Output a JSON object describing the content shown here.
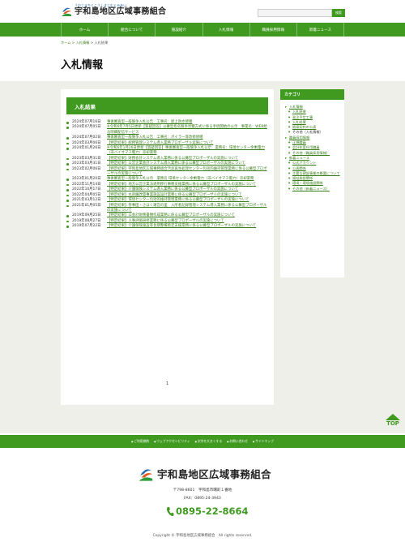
{
  "header": {
    "tagline": "うわじまちくこうしきじむくみあい",
    "site_name": "宇和島地区広域事務組合",
    "search_placeholder": "",
    "search_button": "検索"
  },
  "nav": {
    "items": [
      "ホーム",
      "組合について",
      "施設紹介",
      "入札情報",
      "職員採用情報",
      "新着ニュース"
    ]
  },
  "breadcrumb": {
    "home": "ホーム",
    "sep1": " > ",
    "parent": "入札情報",
    "sep2": " > ",
    "current": "入札結果"
  },
  "page_title": "入札情報",
  "main": {
    "heading": "入札結果",
    "items": [
      {
        "date": "2024年07月16日",
        "title": "事後審査型一般競争入札公告　工事名：屋上防水修繕"
      },
      {
        "date": "2024年07月05日",
        "title": "※令和6年7月5日更新【質疑回答】公募型指名競争見積方式に係る手続開始の公示　事業名：WEB給与明細配信サービス"
      },
      {
        "date": "2024年07月02日",
        "title": "事後審査型一般競争入札公告　工事名：ボイラー等改修修繕"
      },
      {
        "date": "2024年03月06日",
        "title": "【特定結果】総務管理システム導入業務プロポーザル実施について"
      },
      {
        "date": "2024年01月26日",
        "title": "※令和6年1月26日更新【質疑回答】事後審査型一般競争入札公示　業務名：環境センター余剰電力（非バイオマス電力）売却業務"
      },
      {
        "date": "2023年03月31日",
        "title": "【特定結果】財務会計システム導入業務に係る公募型プロポーザルの実施について"
      },
      {
        "date": "2023年03月31日",
        "title": "【特定結果】公営企業会計システム導入業務に係る公募型プロポーザルの実施について"
      },
      {
        "date": "2023年02月06日",
        "title": "【特定結果】宇和島地区広域事務組合汚泥再生処理センター包括的維持管理業務に係る公募型プロポーザルの実施について"
      },
      {
        "date": "2023年01月20日",
        "title": "事後審査型一般競争入札公示　業務名 環境センター余剰電力（非バイオマス電力）売却業務"
      },
      {
        "date": "2022年11月14日",
        "title": "【特定結果】地方公営企業法適用移行事務支援業務に係る公募型プロポーザルの実施について"
      },
      {
        "date": "2022年10月17日",
        "title": "【特定結果】介護保険システム導入業務に係る公募型プロポーザルの実施について"
      },
      {
        "date": "2022年04月05日",
        "title": "【特定結果】丸串園改築事業施設設計業務に係る公募型プロポーザルの実施について"
      },
      {
        "date": "2021年03月12日",
        "title": "【特定結果】環境センター包括的維持管理業務に係る公募型プロポーザルの実施について"
      },
      {
        "date": "2021年01月05日",
        "title": "【特定結果】券事田・さほく運営の里　入所者記録管理システム導入業務に係る公募型プロポーザルの実施について"
      },
      {
        "date": "2019年09月25日",
        "title": "【特定結果】公会計財務書類作成業務に係る公募型プロポーザルの実施について"
      },
      {
        "date": "2019年08月27日",
        "title": "【特定結果】人事評価研修業務に係る公募型プロポーザルの実施について"
      },
      {
        "date": "2019年07月22日",
        "title": "【特定結果】介護保険施設等長期整備策定支援業務に係る公募型プロポーザルの実施について"
      }
    ],
    "page_number": "1"
  },
  "sidebar": {
    "heading": "カテゴリ",
    "groups": [
      {
        "label": "入札情報",
        "items": [
          {
            "label": "入札結果",
            "link": true
          },
          {
            "label": "発注予定工事",
            "link": true
          },
          {
            "label": "入札結果",
            "link": true
          },
          {
            "label": "随意契約の公表",
            "link": true
          },
          {
            "label": "その他（入札情報）",
            "link": false
          }
        ]
      },
      {
        "label": "職員採用情報",
        "items": [
          {
            "label": "正規職員",
            "link": true
          },
          {
            "label": "会計年度任用職員",
            "link": true
          },
          {
            "label": "その他（職員採用情報）",
            "link": true
          }
        ]
      },
      {
        "label": "新着ニュース",
        "items": [
          {
            "label": "公式アカウント",
            "link": true
          },
          {
            "label": "公表関係",
            "link": true
          },
          {
            "label": "主要な建設事業の概要について",
            "link": true
          },
          {
            "label": "福祉施設関係",
            "link": true
          },
          {
            "label": "環境・環境施設関係",
            "link": true
          },
          {
            "label": "その他（新着ニュース）",
            "link": true
          }
        ]
      }
    ]
  },
  "top_button": "TOP",
  "footer": {
    "links": [
      "ご利用規約",
      "ウェブアクセシビリティ",
      "文字を大きくする",
      "お問い合わせ",
      "サイトマップ"
    ],
    "org_name": "宇和島地区広域事務組合",
    "address": "〒798-8601　宇和島市曙町１番地",
    "fax": "FAX：0895-24-3943",
    "phone": "0895-22-8664",
    "copyright": "Copyright © 宇和島地区広域事務組合　All rights reserved."
  },
  "colors": {
    "brand_green": "#3f9a1f",
    "link_green": "#3a7d1c",
    "band_bg": "#efefe9"
  }
}
